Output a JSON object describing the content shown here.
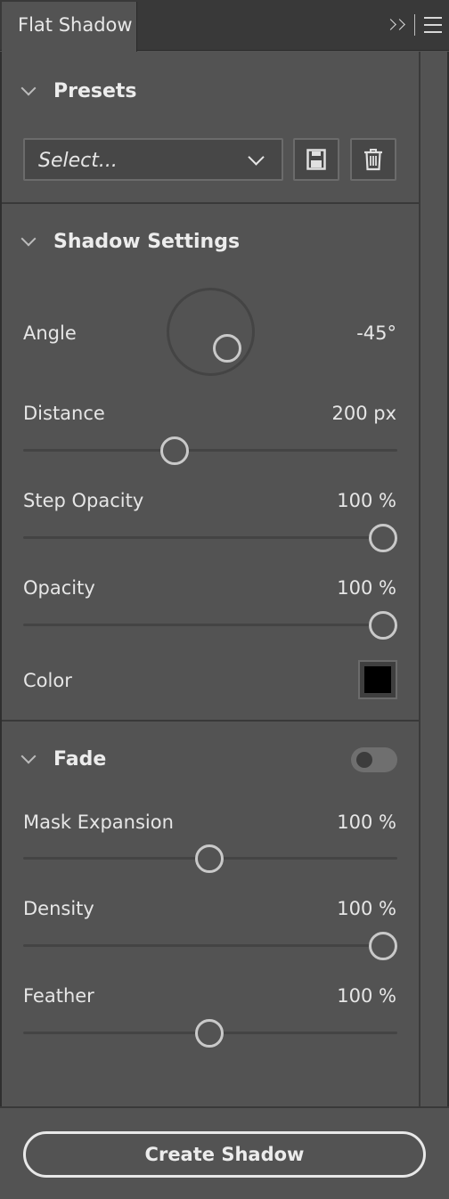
{
  "tab": {
    "title": "Flat Shadow"
  },
  "presets": {
    "title": "Presets",
    "select_value": "Select..."
  },
  "shadow": {
    "title": "Shadow Settings",
    "angle": {
      "label": "Angle",
      "value": "-45°"
    },
    "distance": {
      "label": "Distance",
      "value": "200 px",
      "slider_fraction": 0.4
    },
    "step_opacity": {
      "label": "Step Opacity",
      "value": "100 %",
      "slider_fraction": 1.0
    },
    "opacity": {
      "label": "Opacity",
      "value": "100 %",
      "slider_fraction": 1.0
    },
    "color": {
      "label": "Color",
      "swatch": "#000000"
    }
  },
  "fade": {
    "title": "Fade",
    "enabled": false,
    "mask_expansion": {
      "label": "Mask Expansion",
      "value": "100 %",
      "slider_fraction": 0.5
    },
    "density": {
      "label": "Density",
      "value": "100 %",
      "slider_fraction": 1.0
    },
    "feather": {
      "label": "Feather",
      "value": "100 %",
      "slider_fraction": 0.5
    }
  },
  "footer": {
    "create_label": "Create Shadow"
  },
  "colors": {
    "panel_bg": "#535353",
    "header_bg": "#393939",
    "text": "#e6e6e6",
    "knob_border": "#c9c9c9"
  }
}
